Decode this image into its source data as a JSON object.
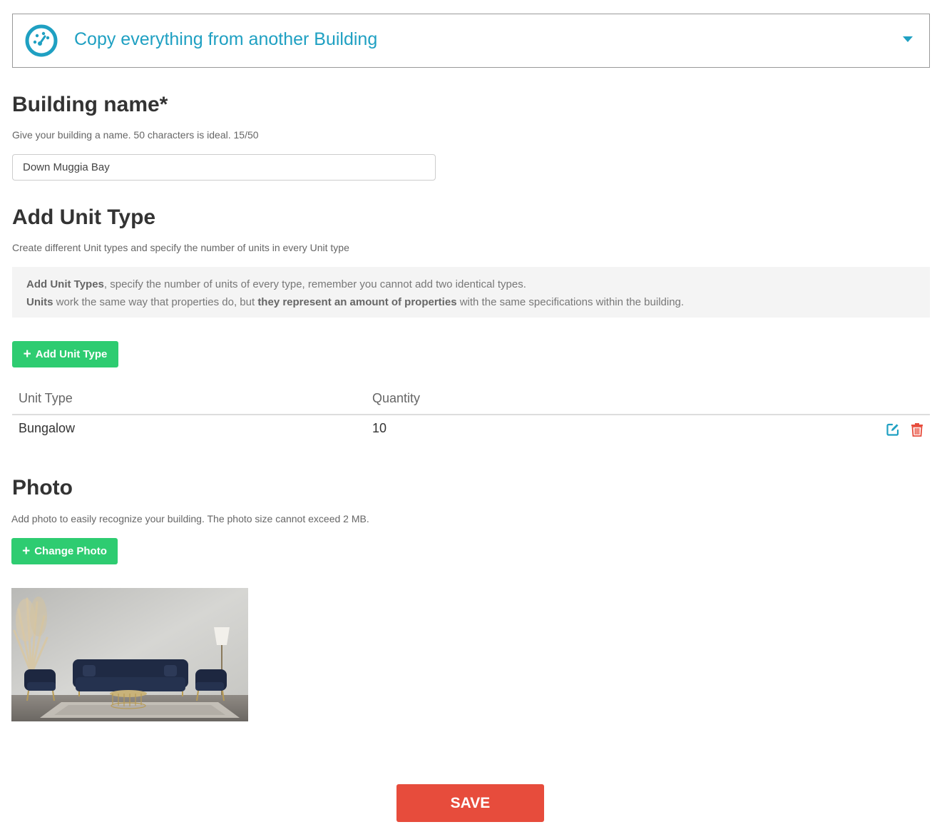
{
  "copy_panel": {
    "title": "Copy everything from another Building",
    "icon": "dashboard-icon",
    "accent_color": "#1fa0c2"
  },
  "building_name": {
    "heading": "Building name*",
    "hint": "Give your building a name. 50 characters is ideal. 15/50",
    "value": "Down Muggia Bay"
  },
  "unit_type": {
    "heading": "Add Unit Type",
    "hint": "Create different Unit types and specify the number of units in every Unit type",
    "info_line1_bold": "Add Unit Types",
    "info_line1_rest": ", specify the number of units of every type, remember you cannot add two identical types.",
    "info_line2_bold1": "Units",
    "info_line2_mid": " work the same way that properties do, but ",
    "info_line2_bold2": "they represent an amount of properties",
    "info_line2_rest": " with the same specifications within the building.",
    "add_button": "Add Unit Type",
    "table": {
      "headers": [
        "Unit Type",
        "Quantity"
      ],
      "rows": [
        {
          "unit_type": "Bungalow",
          "quantity": "10"
        }
      ]
    }
  },
  "photo": {
    "heading": "Photo",
    "hint": "Add photo to easily recognize your building. The photo size cannot exceed 2 MB.",
    "change_button": "Change Photo"
  },
  "save_button": "SAVE",
  "colors": {
    "green": "#2ecc71",
    "red": "#e74c3c",
    "accent": "#1fa0c2"
  }
}
